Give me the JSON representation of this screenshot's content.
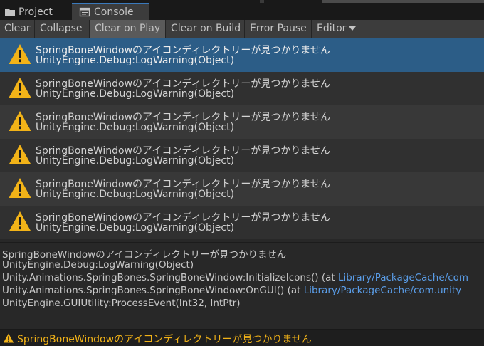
{
  "tabs": [
    {
      "label": "Project",
      "icon": "folder-icon"
    },
    {
      "label": "Console",
      "icon": "console-icon"
    }
  ],
  "toolbar": {
    "clear": "Clear",
    "collapse": "Collapse",
    "clear_on_play": "Clear on Play",
    "clear_on_build": "Clear on Build",
    "error_pause": "Error Pause",
    "editor": "Editor"
  },
  "logs": [
    {
      "message": "SpringBoneWindowのアイコンディレクトリーが見つかりません",
      "source": "UnityEngine.Debug:LogWarning(Object)"
    },
    {
      "message": "SpringBoneWindowのアイコンディレクトリーが見つかりません",
      "source": "UnityEngine.Debug:LogWarning(Object)"
    },
    {
      "message": "SpringBoneWindowのアイコンディレクトリーが見つかりません",
      "source": "UnityEngine.Debug:LogWarning(Object)"
    },
    {
      "message": "SpringBoneWindowのアイコンディレクトリーが見つかりません",
      "source": "UnityEngine.Debug:LogWarning(Object)"
    },
    {
      "message": "SpringBoneWindowのアイコンディレクトリーが見つかりません",
      "source": "UnityEngine.Debug:LogWarning(Object)"
    },
    {
      "message": "SpringBoneWindowのアイコンディレクトリーが見つかりません",
      "source": "UnityEngine.Debug:LogWarning(Object)"
    }
  ],
  "detail": {
    "line1": "SpringBoneWindowのアイコンディレクトリーが見つかりません",
    "line2": "UnityEngine.Debug:LogWarning(Object)",
    "line3_prefix": "Unity.Animations.SpringBones.SpringBoneWindow:InitializeIcons() (at ",
    "line3_link": "Library/PackageCache/com",
    "line4_prefix": "Unity.Animations.SpringBones.SpringBoneWindow:OnGUI() (at ",
    "line4_link": "Library/PackageCache/com.unity",
    "line5": "UnityEngine.GUIUtility:ProcessEvent(Int32, IntPtr)"
  },
  "status": {
    "message": "SpringBoneWindowのアイコンディレクトリーが見つかりません",
    "icon": "warning-icon"
  },
  "colors": {
    "selected_row": "#2c5d87",
    "warning": "#f2b318",
    "link": "#5a9de8",
    "tab_accent": "#3a79bb"
  }
}
